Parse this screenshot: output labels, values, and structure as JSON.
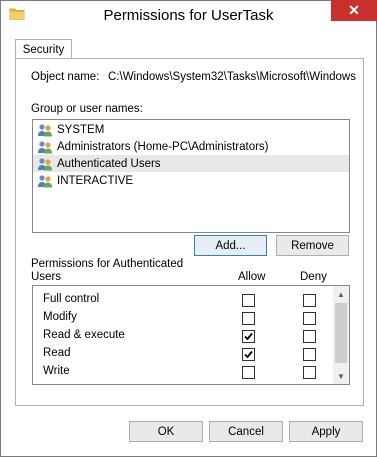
{
  "window": {
    "title": "Permissions for UserTask",
    "close_glyph": "✕"
  },
  "tabs": [
    {
      "label": "Security",
      "active": true
    }
  ],
  "object_name": {
    "label": "Object name:",
    "value": "C:\\Windows\\System32\\Tasks\\Microsoft\\Windows"
  },
  "groups": {
    "label": "Group or user names:",
    "items": [
      {
        "label": "SYSTEM",
        "icon": "users-icon",
        "selected": false
      },
      {
        "label": "Administrators (Home-PC\\Administrators)",
        "icon": "users-icon",
        "selected": false
      },
      {
        "label": "Authenticated Users",
        "icon": "users-icon",
        "selected": true
      },
      {
        "label": "INTERACTIVE",
        "icon": "users-icon",
        "selected": false
      }
    ],
    "add_label": "Add...",
    "remove_label": "Remove"
  },
  "permissions": {
    "heading_line1": "Permissions for Authenticated",
    "heading_line2": "Users",
    "allow_header": "Allow",
    "deny_header": "Deny",
    "rows": [
      {
        "name": "Full control",
        "allow": false,
        "deny": false
      },
      {
        "name": "Modify",
        "allow": false,
        "deny": false
      },
      {
        "name": "Read & execute",
        "allow": true,
        "deny": false
      },
      {
        "name": "Read",
        "allow": true,
        "deny": false
      },
      {
        "name": "Write",
        "allow": false,
        "deny": false
      }
    ]
  },
  "buttons": {
    "ok": "OK",
    "cancel": "Cancel",
    "apply": "Apply"
  },
  "colors": {
    "close_button": "#c7302b",
    "selection": "#e8e8e8",
    "default_button_border": "#3c7fb1"
  }
}
